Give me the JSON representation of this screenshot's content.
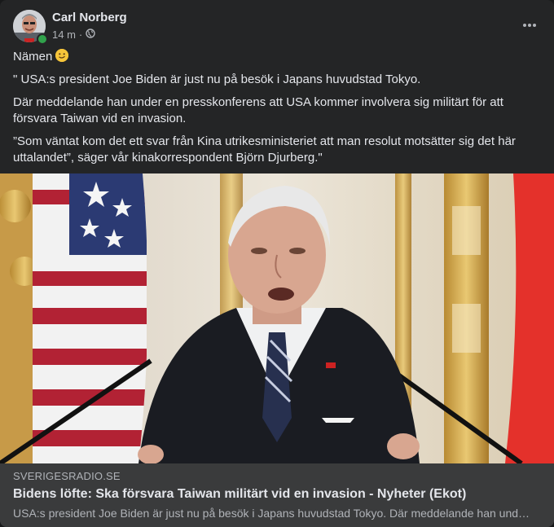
{
  "post": {
    "author": "Carl Norberg",
    "time": "14 m",
    "separator": "·",
    "audience_icon": "globe-icon",
    "more_icon": "more-horizontal-icon",
    "text": {
      "line1": "Nämen",
      "emoji": "slightly-smiling-face",
      "para1": "\" USA:s president Joe Biden är just nu på besök i Japans huvudstad Tokyo.",
      "para2": "Där meddelande han under en presskonferens att USA kommer involvera sig militärt för att försvara Taiwan vid en invasion.",
      "para3": "”Som väntat kom det ett svar från Kina utrikesministeriet att man resolut motsätter sig det här uttalandet”, säger vår kinakorrespondent Björn Djurberg.\""
    }
  },
  "link_preview": {
    "domain": "SVERIGESRADIO.SE",
    "title": "Bidens löfte: Ska försvara Taiwan militärt vid en invasion - Nyheter (Ekot)",
    "description": "USA:s president Joe Biden är just nu på besök i Japans huvudstad Tokyo. Där meddelande han under en presskonferens att USA kommer involvera sig militärt för att försvara Taiwan vid en invasion."
  },
  "colors": {
    "card_bg": "#242526",
    "primary_text": "#e4e6eb",
    "secondary_text": "#b0b3b8",
    "preview_bg": "#3a3b3c",
    "online": "#31a24c"
  }
}
